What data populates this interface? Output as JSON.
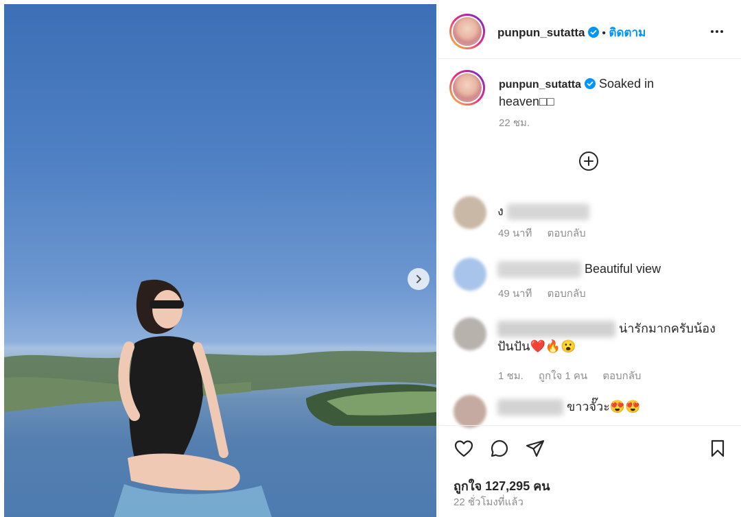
{
  "post": {
    "image_alt": "woman in black swimsuit sitting at infinity pool above lake",
    "next_icon": "chevron-right-icon"
  },
  "header": {
    "username": "punpun_sutatta",
    "separator": "•",
    "follow_label": "ติดตาม",
    "more_icon": "more-horizontal-icon"
  },
  "caption": {
    "username": "punpun_sutatta",
    "text": "Soaked in heaven□□",
    "time": "22 ชม."
  },
  "load_more_icon": "plus-circle-icon",
  "comments": [
    {
      "visible_text": "ง",
      "time": "49 นาที",
      "likes": "",
      "reply_label": "ตอบกลับ"
    },
    {
      "visible_text": "Beautiful view",
      "time": "49 นาที",
      "likes": "",
      "reply_label": "ตอบกลับ"
    },
    {
      "visible_text": "น่ารักมากครับน้องปันปัน❤️🔥😮",
      "time": "1 ชม.",
      "likes": "ถูกใจ 1 คน",
      "reply_label": "ตอบกลับ"
    },
    {
      "visible_text": "ขาวจั๊วะ😍😍",
      "time": "",
      "likes": "",
      "reply_label": ""
    }
  ],
  "actions": {
    "like_icon": "heart-icon",
    "comment_icon": "comment-icon",
    "share_icon": "send-icon",
    "save_icon": "bookmark-icon",
    "likes_text": "ถูกใจ 127,295 คน",
    "posted_time": "22 ชั่วโมงที่แล้ว"
  },
  "colors": {
    "accent": "#0095f6",
    "text": "#262626",
    "secondary": "#8e8e8e",
    "heart_red": "#ed4956"
  }
}
